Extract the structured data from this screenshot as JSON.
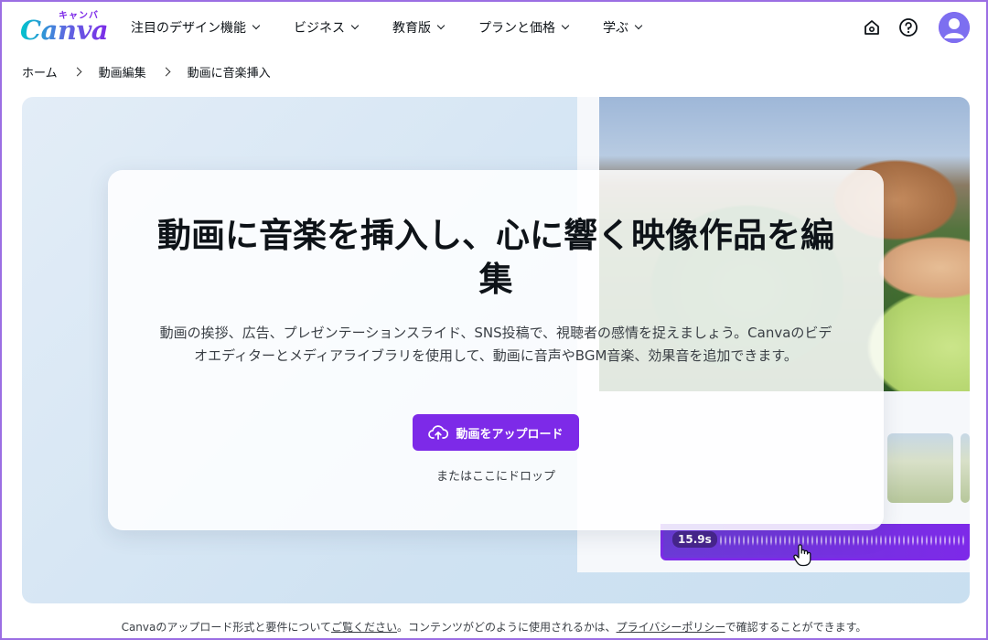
{
  "brand": {
    "name": "Canva",
    "kana": "キャンバ",
    "color_a": "#00c4cc",
    "color_b": "#7d2ae8"
  },
  "nav": {
    "items": [
      {
        "label": "注目のデザイン機能"
      },
      {
        "label": "ビジネス"
      },
      {
        "label": "教育版"
      },
      {
        "label": "プランと価格"
      },
      {
        "label": "学ぶ"
      }
    ]
  },
  "header_icons": [
    "home-icon",
    "help-icon",
    "avatar"
  ],
  "breadcrumb": {
    "items": [
      {
        "label": "ホーム"
      },
      {
        "label": "動画編集"
      },
      {
        "label": "動画に音楽挿入"
      }
    ]
  },
  "hero": {
    "title": "動画に音楽を挿入し、心に響く映像作品を編集",
    "description": "動画の挨拶、広告、プレゼンテーションスライド、SNS投稿で、視聴者の感情を捉えましょう。Canvaのビデオエディターとメディアライブラリを使用して、動画に音声やBGM音楽、効果音を追加できます。",
    "upload_label": "動画をアップロード",
    "drop_label": "またはここにドロップ",
    "wave_time": "15.9s",
    "accent": "#7d2ae8"
  },
  "footer": {
    "text_1": "Canvaのアップロード形式と要件について",
    "link_1": "ご覧ください",
    "text_2": "。コンテンツがどのように使用されるかは、",
    "link_2": "プライバシーポリシー",
    "text_3": "で確認することができます。"
  }
}
